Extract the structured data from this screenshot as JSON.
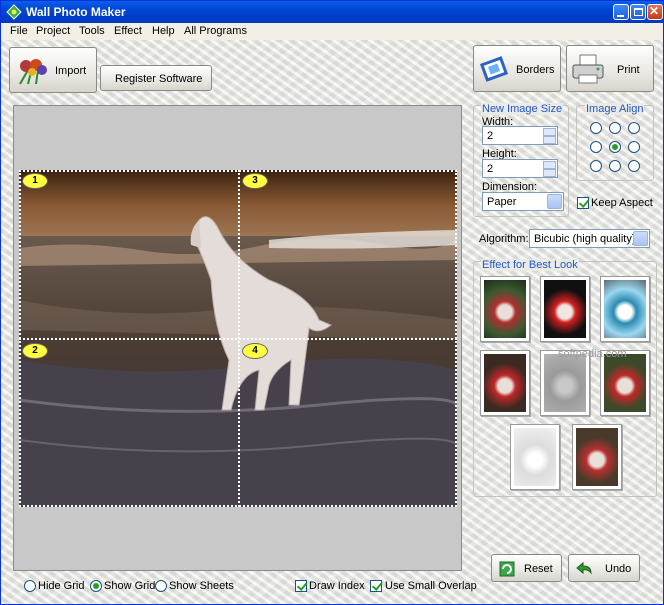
{
  "window": {
    "title": "Wall Photo Maker"
  },
  "menu": [
    "File",
    "Project",
    "Tools",
    "Effect",
    "Help",
    "All Programs"
  ],
  "toolbar": {
    "import_label": "Import",
    "register_label": "Register Software",
    "borders_label": "Borders",
    "print_label": "Print"
  },
  "sheets": [
    "1",
    "2",
    "3",
    "4"
  ],
  "size_group": {
    "title": "New Image Size",
    "width_label": "Width:",
    "width_value": "2",
    "height_label": "Height:",
    "height_value": "2",
    "dimension_label": "Dimension:",
    "dimension_value": "Paper"
  },
  "align_group": {
    "title": "Image Align",
    "selected": 4
  },
  "keep_aspect": {
    "label": "Keep Aspect",
    "checked": true
  },
  "algorithm": {
    "label": "Algorithm:",
    "value": "Bicubic (high quality)"
  },
  "effects": {
    "title": "Effect for Best Look",
    "count": 8
  },
  "watermark": "softpedia.com",
  "actions": {
    "reset_label": "Reset",
    "undo_label": "Undo"
  },
  "view_options": {
    "hide_grid": "Hide Grid",
    "show_grid": "Show Grid",
    "show_sheets": "Show Sheets",
    "selected": "show_grid"
  },
  "toggles": {
    "draw_index": "Draw Index",
    "small_overlap": "Use Small Overlap",
    "draw_index_checked": true,
    "small_overlap_checked": true
  }
}
